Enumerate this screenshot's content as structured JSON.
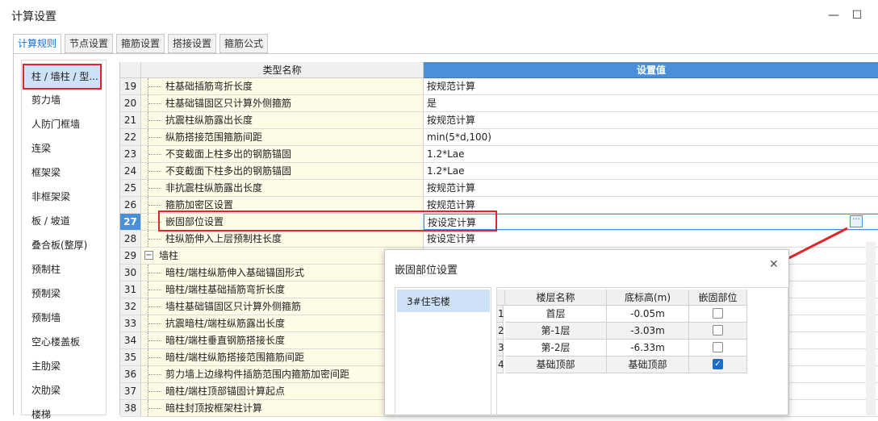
{
  "window": {
    "title": "计算设置"
  },
  "tabs": [
    {
      "label": "计算规则",
      "active": true
    },
    {
      "label": "节点设置"
    },
    {
      "label": "箍筋设置"
    },
    {
      "label": "搭接设置"
    },
    {
      "label": "箍筋公式"
    }
  ],
  "left_list": [
    "柱 / 墙柱 / 型...",
    "剪力墙",
    "人防门框墙",
    "连梁",
    "框架梁",
    "非框架梁",
    "板 / 坡道",
    "叠合板(整厚)",
    "预制柱",
    "预制梁",
    "预制墙",
    "空心楼盖板",
    "主肋梁",
    "次肋梁",
    "楼梯"
  ],
  "grid": {
    "header_name": "类型名称",
    "header_value": "设置值",
    "rows": [
      {
        "num": "19",
        "name": "柱基础插筋弯折长度",
        "value": "按规范计算"
      },
      {
        "num": "20",
        "name": "柱基础锚固区只计算外侧箍筋",
        "value": "是"
      },
      {
        "num": "21",
        "name": "抗震柱纵筋露出长度",
        "value": "按规范计算"
      },
      {
        "num": "22",
        "name": "纵筋搭接范围箍筋间距",
        "value": "min(5*d,100)"
      },
      {
        "num": "23",
        "name": "不变截面上柱多出的钢筋锚固",
        "value": "1.2*Lae"
      },
      {
        "num": "24",
        "name": "不变截面下柱多出的钢筋锚固",
        "value": "1.2*Lae"
      },
      {
        "num": "25",
        "name": "非抗震柱纵筋露出长度",
        "value": "按规范计算"
      },
      {
        "num": "26",
        "name": "箍筋加密区设置",
        "value": "按规范计算"
      },
      {
        "num": "27",
        "name": "嵌固部位设置",
        "value": "按设定计算"
      },
      {
        "num": "28",
        "name": "柱纵筋伸入上层预制柱长度",
        "value": "按设定计算"
      },
      {
        "num": "29",
        "name": "墙柱",
        "value": "",
        "group": true
      },
      {
        "num": "30",
        "name": "暗柱/端柱纵筋伸入基础锚固形式",
        "value": ""
      },
      {
        "num": "31",
        "name": "暗柱/端柱基础插筋弯折长度",
        "value": ""
      },
      {
        "num": "32",
        "name": "墙柱基础锚固区只计算外侧箍筋",
        "value": ""
      },
      {
        "num": "33",
        "name": "抗震暗柱/端柱纵筋露出长度",
        "value": ""
      },
      {
        "num": "34",
        "name": "暗柱/端柱垂直钢筋搭接长度",
        "value": ""
      },
      {
        "num": "35",
        "name": "暗柱/端柱纵筋搭接范围箍筋间距",
        "value": ""
      },
      {
        "num": "36",
        "name": "剪力墙上边缘构件插筋范围内箍筋加密间距",
        "value": ""
      },
      {
        "num": "37",
        "name": "暗柱/端柱顶部锚固计算起点",
        "value": ""
      },
      {
        "num": "38",
        "name": "暗柱封顶按框架柱计算",
        "value": ""
      }
    ],
    "expander_symbol": "−",
    "ellipsis": "···"
  },
  "dialog": {
    "title": "嵌固部位设置",
    "close": "✕",
    "buildings": [
      "3#住宅楼"
    ],
    "headers": [
      "楼层名称",
      "底标高(m)",
      "嵌固部位"
    ],
    "rows": [
      {
        "idx": "1",
        "floor": "首层",
        "elev": "-0.05m",
        "checked": false
      },
      {
        "idx": "2",
        "floor": "第-1层",
        "elev": "-3.03m",
        "checked": false
      },
      {
        "idx": "3",
        "floor": "第-2层",
        "elev": "-6.33m",
        "checked": false
      },
      {
        "idx": "4",
        "floor": "基础顶部",
        "elev": "基础顶部",
        "checked": true
      }
    ],
    "check_mark": "✓"
  },
  "colors": {
    "accent": "#4a8fd8",
    "highlight": "#e0262b",
    "name_bg": "#fefbe6"
  }
}
